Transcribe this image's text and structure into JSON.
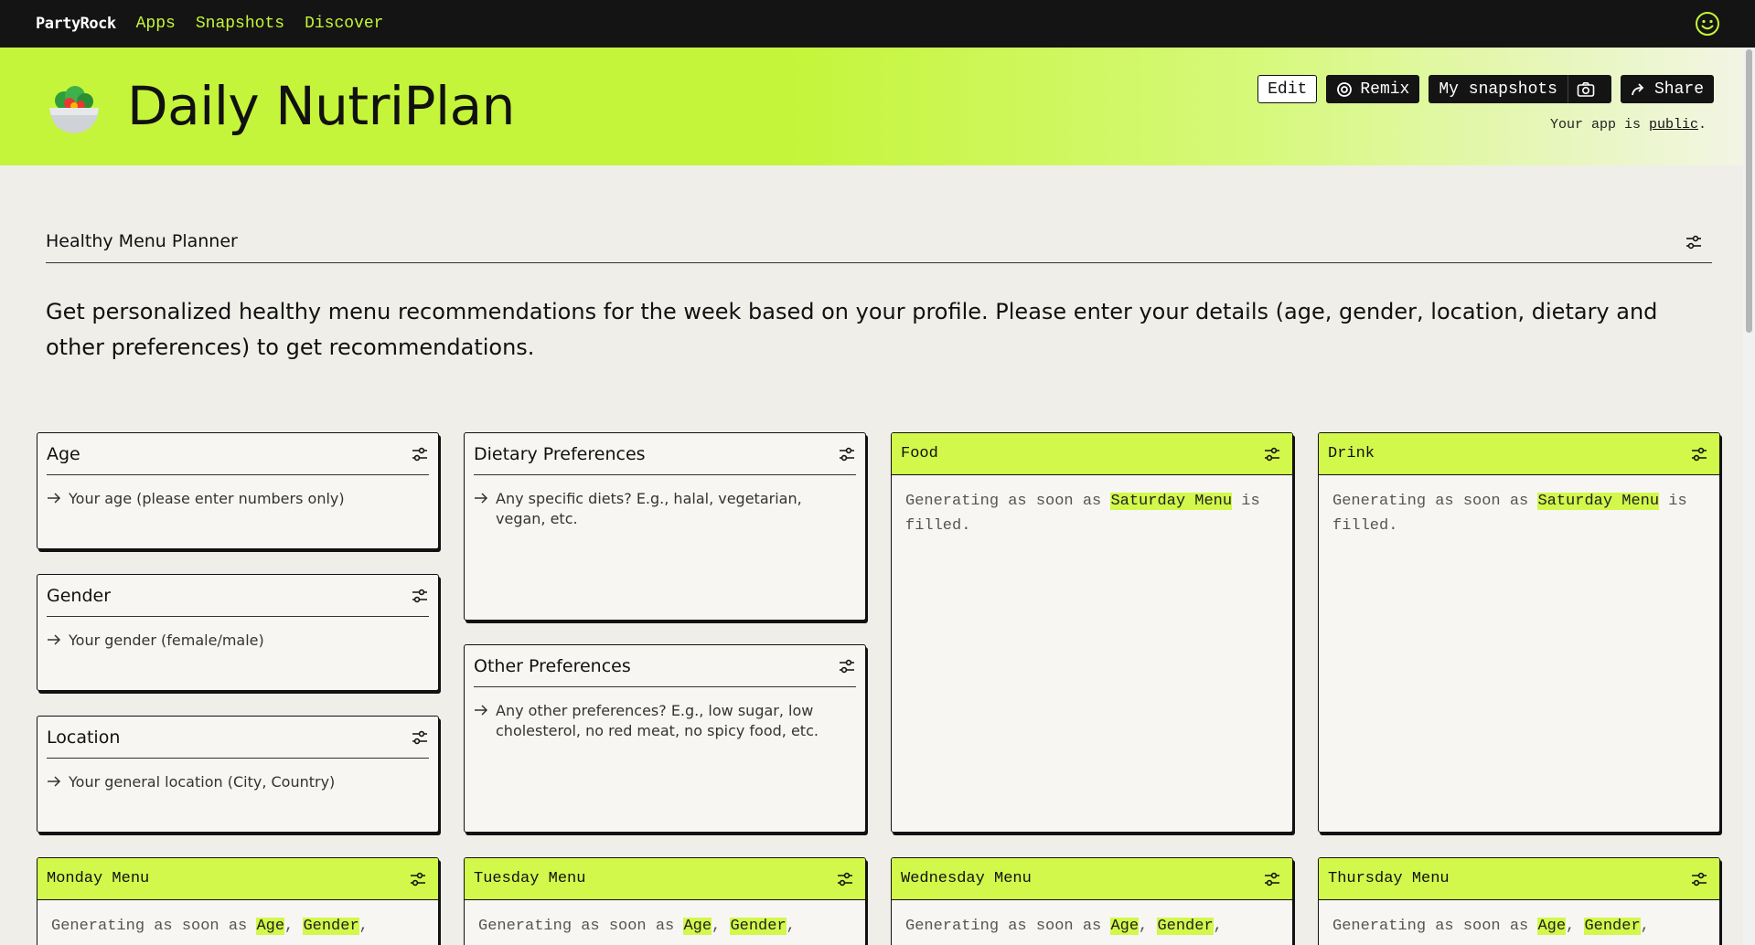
{
  "nav": {
    "brand": "PartyRock",
    "links": [
      "Apps",
      "Snapshots",
      "Discover"
    ],
    "account_icon": "smiley-icon"
  },
  "header": {
    "title": "Daily NutriPlan",
    "emoji_icon": "salad-bowl-icon",
    "buttons": {
      "edit": "Edit",
      "remix": "Remix",
      "snapshots": "My snapshots",
      "share": "Share"
    },
    "public_prefix": "Your app is ",
    "public_link": "public",
    "public_suffix": "."
  },
  "section": {
    "title": "Healthy Menu Planner",
    "description": "Get personalized healthy menu recommendations for the week based on your profile. Please enter your details (age, gender, location, dietary and other preferences) to get recommendations."
  },
  "inputs": {
    "age": {
      "title": "Age",
      "placeholder": "Your age (please enter numbers only)"
    },
    "gender": {
      "title": "Gender",
      "placeholder": "Your gender (female/male)"
    },
    "location": {
      "title": "Location",
      "placeholder": "Your general location (City, Country)"
    },
    "dietary": {
      "title": "Dietary Preferences",
      "placeholder": "Any specific diets? E.g., halal, vegetarian, vegan, etc."
    },
    "other": {
      "title": "Other Preferences",
      "placeholder": "Any other preferences? E.g., low sugar, low cholesterol, no red meat, no spicy food, etc."
    }
  },
  "outputs": {
    "food": {
      "title": "Food",
      "prefix": "Generating as soon as ",
      "dep": "Saturday Menu",
      "suffix": " is filled."
    },
    "drink": {
      "title": "Drink",
      "prefix": "Generating as soon as ",
      "dep": "Saturday Menu",
      "suffix": " is filled."
    },
    "monday": {
      "title": "Monday Menu",
      "prefix": "Generating as soon as ",
      "dep1": "Age",
      "sep": ", ",
      "dep2": "Gender",
      "tail": ","
    },
    "tuesday": {
      "title": "Tuesday Menu",
      "prefix": "Generating as soon as ",
      "dep1": "Age",
      "sep": ", ",
      "dep2": "Gender",
      "tail": ","
    },
    "wednesday": {
      "title": "Wednesday Menu",
      "prefix": "Generating as soon as ",
      "dep1": "Age",
      "sep": ", ",
      "dep2": "Gender",
      "tail": ","
    },
    "thursday": {
      "title": "Thursday Menu",
      "prefix": "Generating as soon as ",
      "dep1": "Age",
      "sep": ", ",
      "dep2": "Gender",
      "tail": ","
    }
  },
  "colors": {
    "accent": "#c5f53a",
    "nav_bg": "#141414",
    "page_bg": "#efeee9"
  }
}
